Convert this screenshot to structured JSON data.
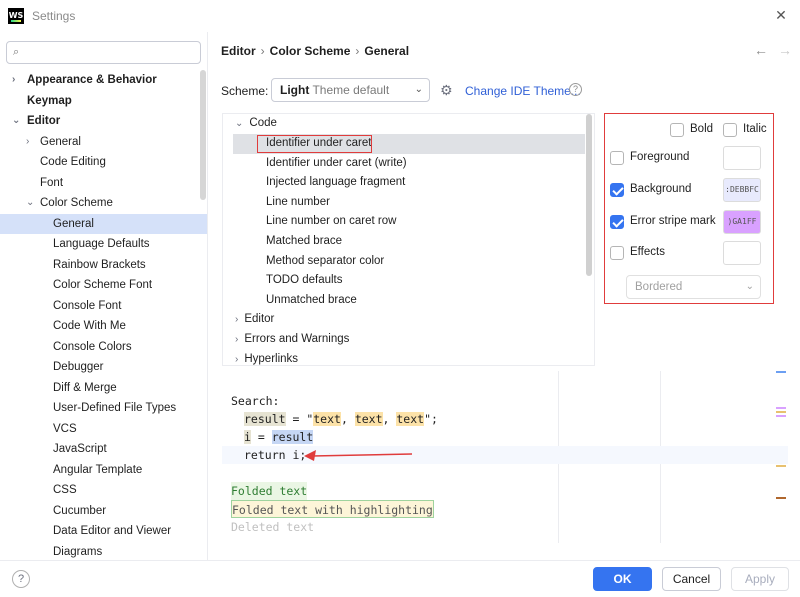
{
  "window": {
    "title": "Settings",
    "logo": "WS"
  },
  "search": {
    "placeholder": "",
    "value": "",
    "icon": "search-icon"
  },
  "sidebar": {
    "items": [
      {
        "label": "Appearance & Behavior"
      },
      {
        "label": "Keymap"
      },
      {
        "label": "Editor"
      },
      {
        "label": "General"
      },
      {
        "label": "Code Editing"
      },
      {
        "label": "Font"
      },
      {
        "label": "Color Scheme"
      },
      {
        "label": "General"
      },
      {
        "label": "Language Defaults"
      },
      {
        "label": "Rainbow Brackets"
      },
      {
        "label": "Color Scheme Font"
      },
      {
        "label": "Console Font"
      },
      {
        "label": "Code With Me"
      },
      {
        "label": "Console Colors"
      },
      {
        "label": "Debugger"
      },
      {
        "label": "Diff & Merge"
      },
      {
        "label": "User-Defined File Types"
      },
      {
        "label": "VCS"
      },
      {
        "label": "JavaScript"
      },
      {
        "label": "Angular Template"
      },
      {
        "label": "CSS"
      },
      {
        "label": "Cucumber"
      },
      {
        "label": "Data Editor and Viewer"
      },
      {
        "label": "Diagrams"
      }
    ]
  },
  "breadcrumb": {
    "a": "Editor",
    "b": "Color Scheme",
    "c": "General",
    "sep": "›"
  },
  "scheme": {
    "label": "Scheme:",
    "name": "Light",
    "sub": "Theme default",
    "change_link": "Change IDE Theme...",
    "help": "?"
  },
  "code_tree": {
    "items": [
      {
        "label": "Code"
      },
      {
        "label": "Identifier under caret"
      },
      {
        "label": "Identifier under caret (write)"
      },
      {
        "label": "Injected language fragment"
      },
      {
        "label": "Line number"
      },
      {
        "label": "Line number on caret row"
      },
      {
        "label": "Matched brace"
      },
      {
        "label": "Method separator color"
      },
      {
        "label": "TODO defaults"
      },
      {
        "label": "Unmatched brace"
      },
      {
        "label": "Editor"
      },
      {
        "label": "Errors and Warnings"
      },
      {
        "label": "Hyperlinks"
      }
    ]
  },
  "attributes": {
    "bold": {
      "label": "Bold",
      "checked": false
    },
    "italic": {
      "label": "Italic",
      "checked": false
    },
    "foreground": {
      "label": "Foreground",
      "checked": false,
      "swatch": ""
    },
    "background": {
      "label": "Background",
      "checked": true,
      "swatch": ":DEBBFC",
      "color": "#e8eafd"
    },
    "error_stripe": {
      "label": "Error stripe mark",
      "checked": true,
      "swatch": ")GA1FF",
      "color": "#d9a1ff"
    },
    "effects": {
      "label": "Effects",
      "checked": false,
      "select_value": "Bordered"
    }
  },
  "preview": {
    "l1": "Search:",
    "l2a": "result",
    "l2b": " = \"",
    "l2c": "text",
    "l2d": ", ",
    "l2e": "text",
    "l2f": ", ",
    "l2g": "text",
    "l2h": "\";",
    "l3a": "i",
    "l3b": " = ",
    "l3c": "result",
    "l4": "return i;",
    "l5": "Folded text",
    "l6": "Folded text with highlighting",
    "l7": "Deleted text"
  },
  "footer": {
    "ok": "OK",
    "cancel": "Cancel",
    "apply": "Apply",
    "help": "?"
  },
  "colors": {
    "accent": "#3574f0",
    "highlight_box": "#e03c3c",
    "selection": "#d5e1f9"
  }
}
